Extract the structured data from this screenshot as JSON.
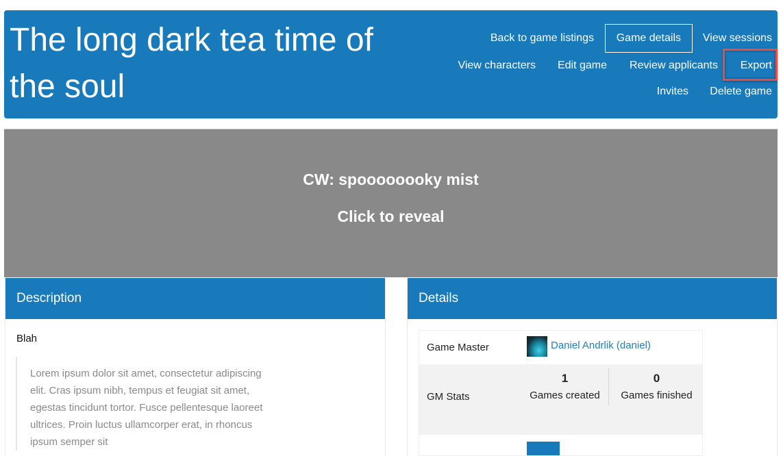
{
  "header": {
    "title": "The long dark tea time of the soul",
    "nav": [
      {
        "label": "Back to game listings",
        "active": false
      },
      {
        "label": "Game details",
        "active": true
      },
      {
        "label": "View sessions",
        "active": false
      },
      {
        "label": "View characters",
        "active": false
      },
      {
        "label": "Edit game",
        "active": false
      },
      {
        "label": "Review applicants",
        "active": false
      },
      {
        "label": "Export",
        "active": false,
        "highlighted": true
      },
      {
        "label": "Invites",
        "active": false
      },
      {
        "label": "Delete game",
        "active": false
      }
    ]
  },
  "content_warning": {
    "title": "CW: spoooooooky mist",
    "action": "Click to reveal"
  },
  "description": {
    "heading": "Description",
    "first_line": "Blah",
    "quote": "Lorem ipsum dolor sit amet, consectetur adipiscing elit. Cras ipsum nibh, tempus et feugiat sit amet, egestas tincidunt tortor. Fusce pellentesque laoreet ultrices. Proin luctus ullamcorper erat, in rhoncus ipsum semper sit"
  },
  "details": {
    "heading": "Details",
    "game_master_label": "Game Master",
    "game_master_name": "Daniel Andrlik (daniel)",
    "gm_stats_label": "GM Stats",
    "games_created_value": "1",
    "games_created_label": "Games created",
    "games_finished_value": "0",
    "games_finished_label": "Games finished"
  },
  "colors": {
    "primary": "#1879bb",
    "cw_background": "#898989",
    "link": "#1f7fc0",
    "annotation": "#ea4d43"
  }
}
